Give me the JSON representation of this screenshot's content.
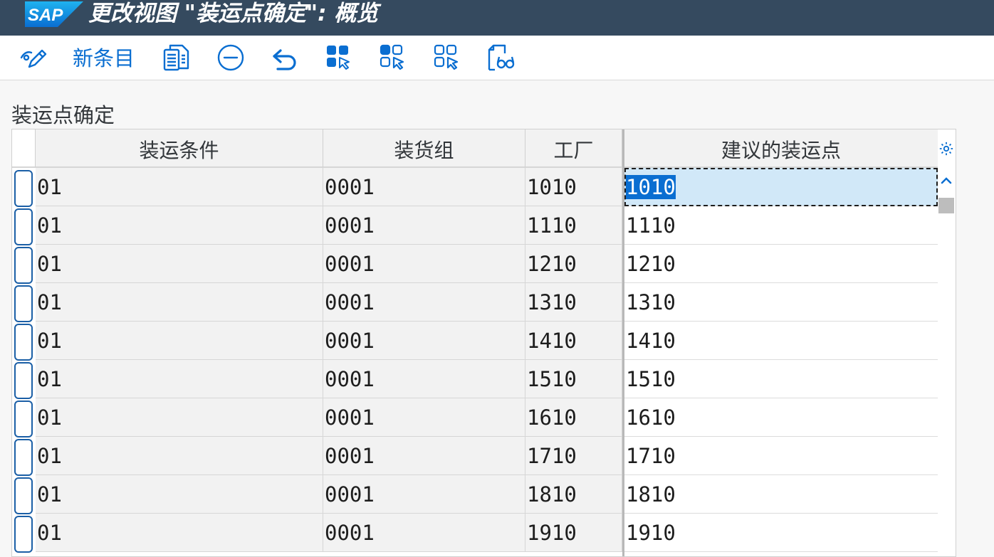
{
  "window": {
    "logo": "SAP",
    "title": "更改视图 \"装运点确定\": 概览"
  },
  "toolbar": {
    "items": [
      {
        "icon": "display-change-icon"
      },
      {
        "label": "新条目"
      },
      {
        "icon": "copy-as-icon"
      },
      {
        "icon": "delete-icon"
      },
      {
        "icon": "undo-icon"
      },
      {
        "icon": "select-all-icon"
      },
      {
        "icon": "select-block-icon"
      },
      {
        "icon": "deselect-all-icon"
      },
      {
        "icon": "print-preview-icon"
      }
    ]
  },
  "section": {
    "title": "装运点确定"
  },
  "table": {
    "columns": [
      "装运条件",
      "装货组",
      "工厂",
      "建议的装运点"
    ],
    "rows": [
      {
        "shipping_condition": "01",
        "loading_group": "0001",
        "plant": "1010",
        "proposed_shipping_point": "1010"
      },
      {
        "shipping_condition": "01",
        "loading_group": "0001",
        "plant": "1110",
        "proposed_shipping_point": "1110"
      },
      {
        "shipping_condition": "01",
        "loading_group": "0001",
        "plant": "1210",
        "proposed_shipping_point": "1210"
      },
      {
        "shipping_condition": "01",
        "loading_group": "0001",
        "plant": "1310",
        "proposed_shipping_point": "1310"
      },
      {
        "shipping_condition": "01",
        "loading_group": "0001",
        "plant": "1410",
        "proposed_shipping_point": "1410"
      },
      {
        "shipping_condition": "01",
        "loading_group": "0001",
        "plant": "1510",
        "proposed_shipping_point": "1510"
      },
      {
        "shipping_condition": "01",
        "loading_group": "0001",
        "plant": "1610",
        "proposed_shipping_point": "1610"
      },
      {
        "shipping_condition": "01",
        "loading_group": "0001",
        "plant": "1710",
        "proposed_shipping_point": "1710"
      },
      {
        "shipping_condition": "01",
        "loading_group": "0001",
        "plant": "1810",
        "proposed_shipping_point": "1810"
      },
      {
        "shipping_condition": "01",
        "loading_group": "0001",
        "plant": "1910",
        "proposed_shipping_point": "1910"
      }
    ]
  },
  "colors": {
    "titlebar": "#354a5f",
    "accent": "#0a6ed1",
    "selection": "#d1e8f8"
  }
}
